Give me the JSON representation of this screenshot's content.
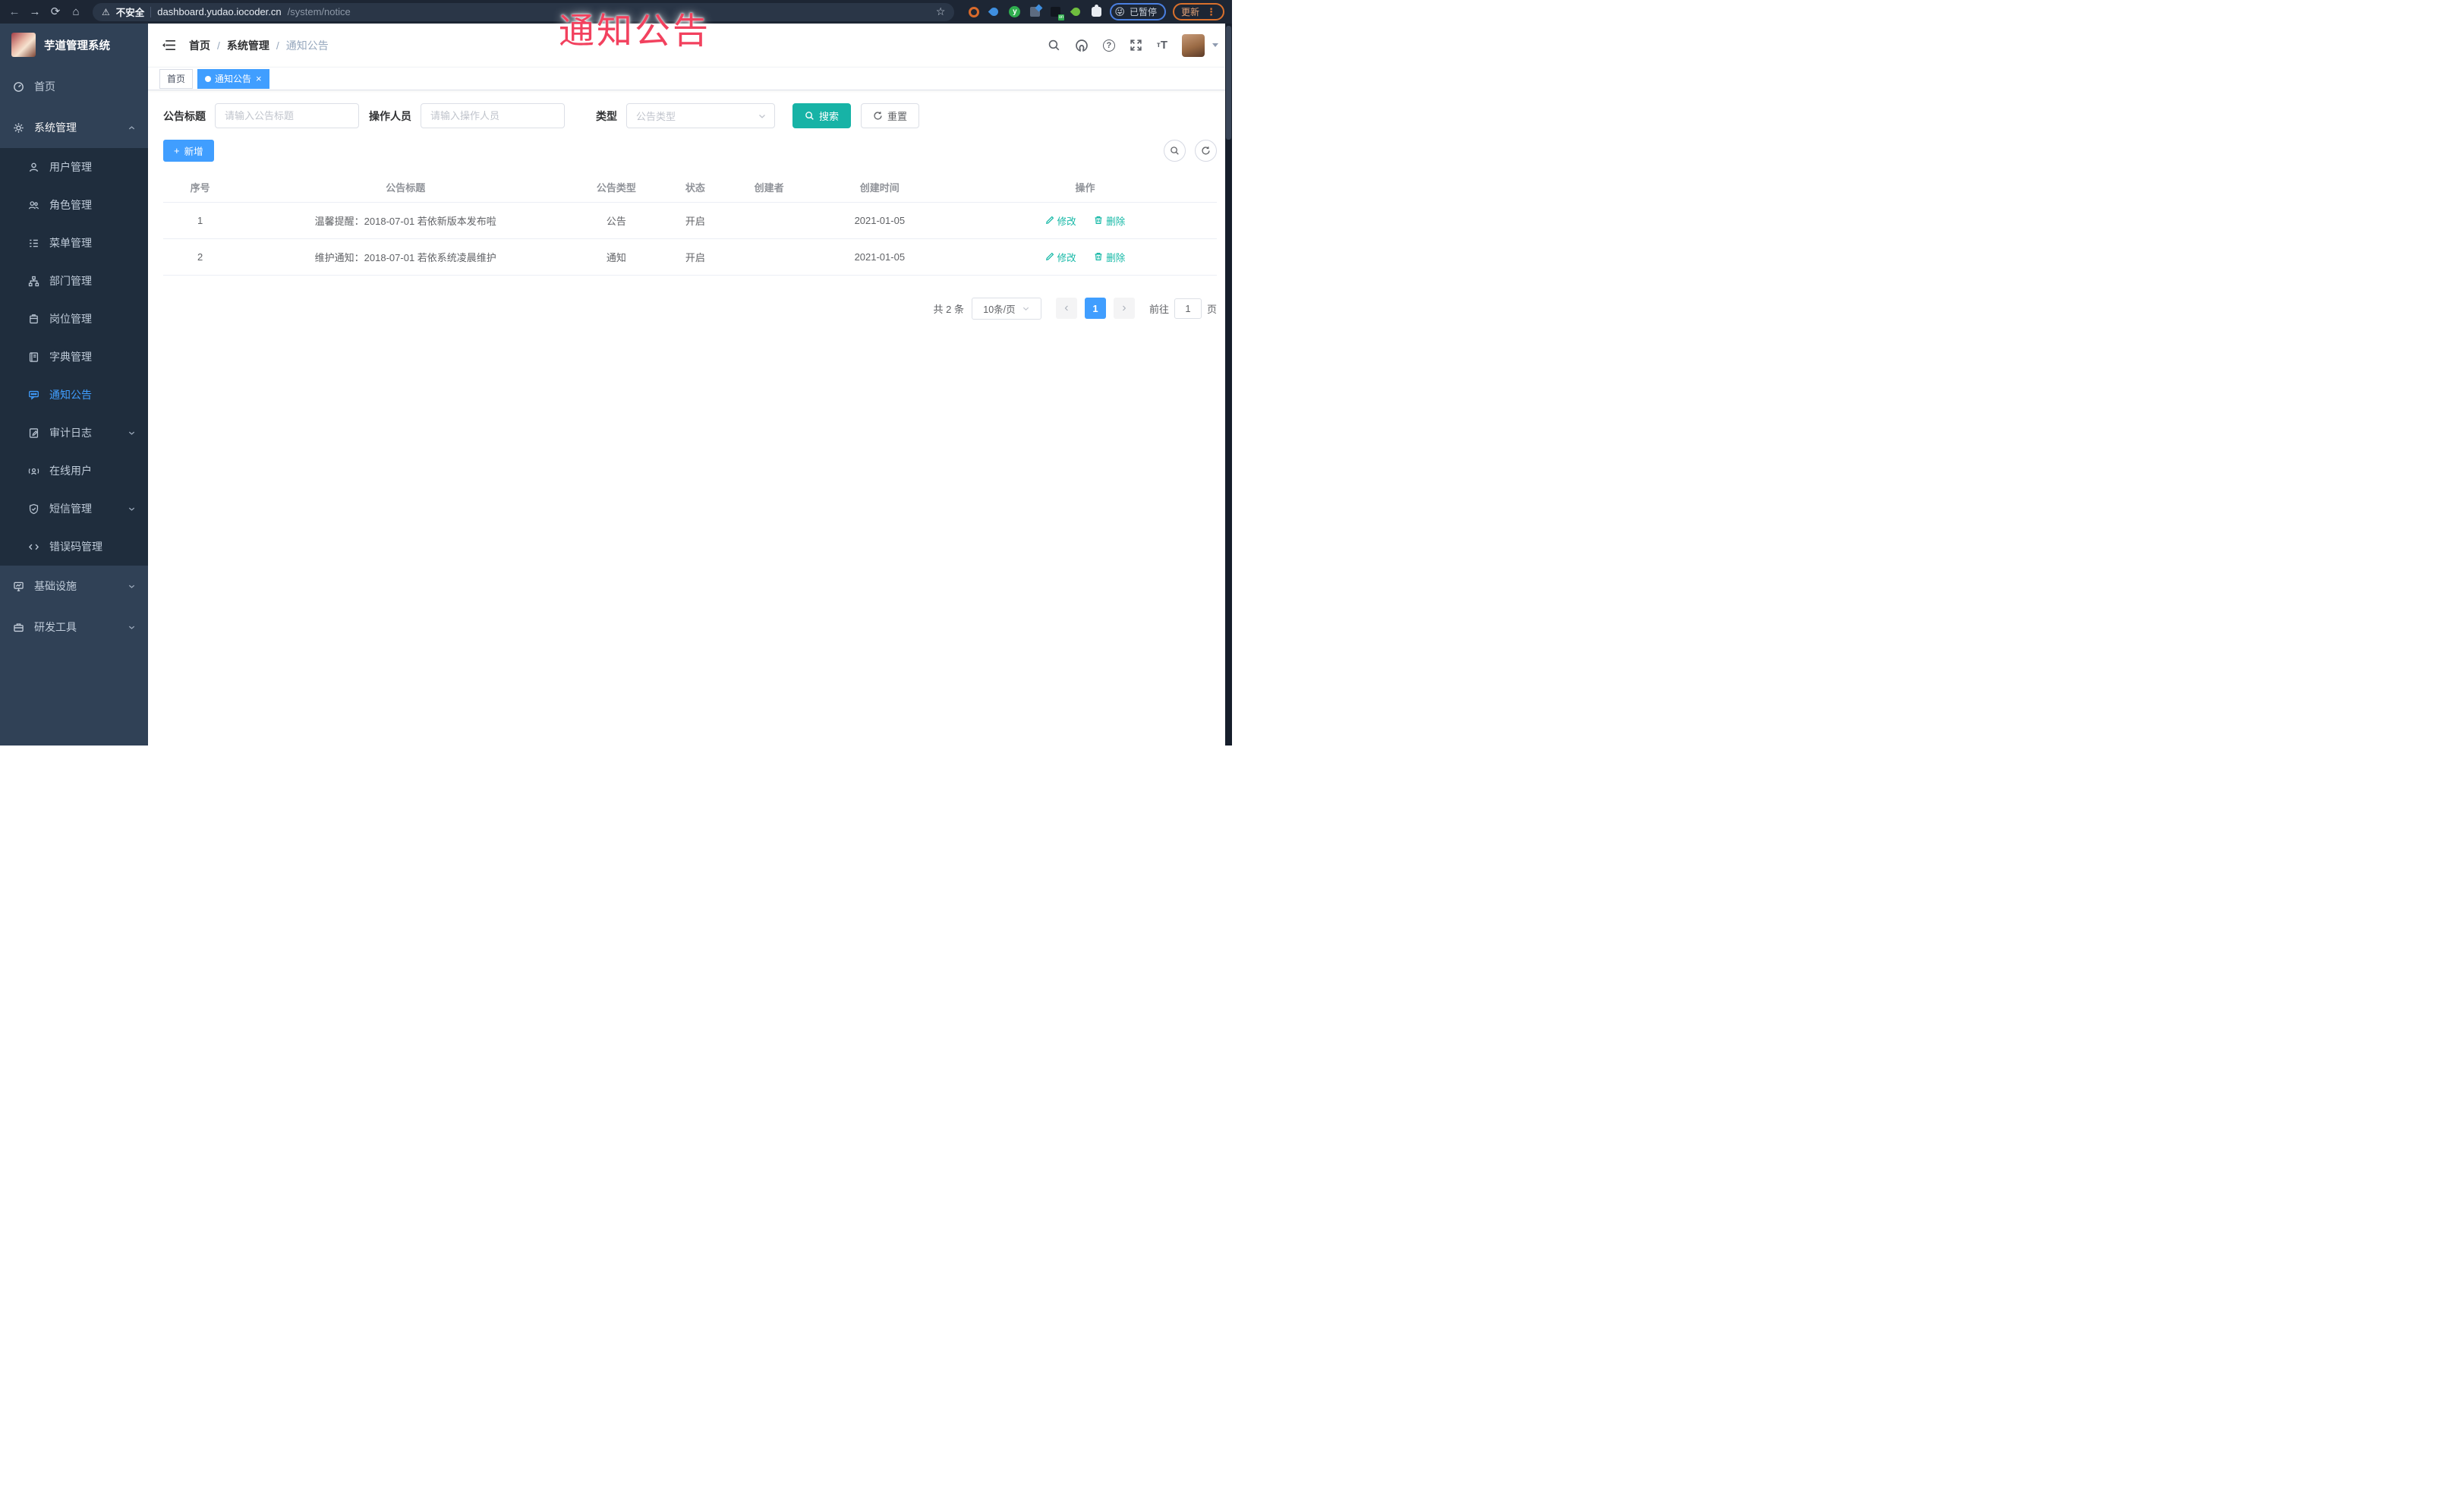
{
  "annotation": {
    "text": "通知公告"
  },
  "browser": {
    "security_label": "不安全",
    "url_host": "dashboard.yudao.iocoder.cn",
    "url_path": "/system/notice",
    "ext_on_badge": "on",
    "paused_label": "已暂停",
    "update_label": "更新"
  },
  "icons": {
    "back": "←",
    "forward": "→",
    "reload": "⟳",
    "home": "⌂",
    "warning": "⚠",
    "star": "☆",
    "emoji": "😜",
    "kebab": "⋮",
    "plus": "+",
    "close": "×",
    "prev": "‹",
    "next": "›",
    "question": "?",
    "font_small": "т",
    "font_big": "T"
  },
  "sidebar": {
    "app_title": "芋道管理系统",
    "items": [
      {
        "label": "首页"
      },
      {
        "label": "系统管理"
      },
      {
        "label": "用户管理"
      },
      {
        "label": "角色管理"
      },
      {
        "label": "菜单管理"
      },
      {
        "label": "部门管理"
      },
      {
        "label": "岗位管理"
      },
      {
        "label": "字典管理"
      },
      {
        "label": "通知公告"
      },
      {
        "label": "审计日志"
      },
      {
        "label": "在线用户"
      },
      {
        "label": "短信管理"
      },
      {
        "label": "错误码管理"
      },
      {
        "label": "基础设施"
      },
      {
        "label": "研发工具"
      }
    ]
  },
  "header": {
    "breadcrumb": [
      "首页",
      "系统管理",
      "通知公告"
    ],
    "separator": "/"
  },
  "tags": [
    {
      "label": "首页"
    },
    {
      "label": "通知公告"
    }
  ],
  "filters": {
    "title_label": "公告标题",
    "title_placeholder": "请输入公告标题",
    "operator_label": "操作人员",
    "operator_placeholder": "请输入操作人员",
    "type_label": "类型",
    "type_placeholder": "公告类型",
    "search_label": "搜索",
    "reset_label": "重置"
  },
  "toolbar": {
    "add_label": "新增"
  },
  "table": {
    "columns": [
      "序号",
      "公告标题",
      "公告类型",
      "状态",
      "创建者",
      "创建时间",
      "操作"
    ],
    "edit_label": "修改",
    "delete_label": "删除",
    "rows": [
      {
        "no": "1",
        "title": "温馨提醒：2018-07-01 若依新版本发布啦",
        "type": "公告",
        "status": "开启",
        "creator": "",
        "created": "2021-01-05"
      },
      {
        "no": "2",
        "title": "维护通知：2018-07-01 若依系统凌晨维护",
        "type": "通知",
        "status": "开启",
        "creator": "",
        "created": "2021-01-05"
      }
    ]
  },
  "pagination": {
    "total_text": "共 2 条",
    "page_size": "10条/页",
    "current_page": "1",
    "goto_label": "前往",
    "goto_value": "1",
    "page_unit": "页"
  },
  "colors": {
    "accent": "#409eff",
    "search_teal": "#17b3a6",
    "op_link": "#14b8a6",
    "annotation_red": "#f2415e",
    "sidebar_bg": "#304156",
    "submenu_bg": "#1f2d3d"
  }
}
